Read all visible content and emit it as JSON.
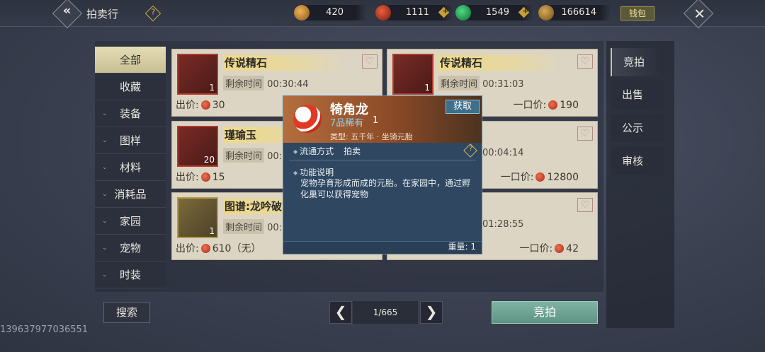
{
  "header": {
    "title": "拍卖行",
    "help_icon": "question-icon",
    "wallet_label": "钱包",
    "currencies": [
      {
        "name": "gold-ingot-icon",
        "value": "420",
        "color": "#c9862e"
      },
      {
        "name": "red-coin-icon",
        "value": "1111",
        "color": "#c23a22"
      },
      {
        "name": "jade-icon",
        "value": "1549",
        "color": "#2fae5a"
      },
      {
        "name": "bronze-icon",
        "value": "166614",
        "color": "#b58a3a"
      }
    ]
  },
  "sidebar": {
    "items": [
      {
        "label": "全部",
        "active": true
      },
      {
        "label": "收藏"
      },
      {
        "label": "装备",
        "chevron": "⌄"
      },
      {
        "label": "图样",
        "chevron": "⌄"
      },
      {
        "label": "材料",
        "chevron": "⌄"
      },
      {
        "label": "消耗品",
        "chevron": "⌄"
      },
      {
        "label": "家园",
        "chevron": "⌄"
      },
      {
        "label": "宠物",
        "chevron": "⌄"
      },
      {
        "label": "时装",
        "chevron": "⌄"
      }
    ]
  },
  "listings": [
    {
      "name": "传说精石",
      "time_label": "剩余时间",
      "time": "00:30:44",
      "qty": "1",
      "price_label": "出价:",
      "price": "30"
    },
    {
      "name": "传说精石",
      "time_label": "剩余时间",
      "time": "00:31:03",
      "qty": "1",
      "price_label": "一口价:",
      "price": "190"
    },
    {
      "name": "瑾瑜玉",
      "time_label": "剩余时间",
      "time": "00:",
      "qty": "20",
      "price_label": "出价:",
      "price": "15"
    },
    {
      "name": "",
      "time_label": "",
      "time": "00:04:14",
      "qty": "",
      "price_label": "一口价:",
      "price": "12800"
    },
    {
      "name": "图谱:龙吟破",
      "time_label": "剩余时间",
      "time": "00:",
      "qty": "1",
      "price_label": "出价:",
      "price": "610（无）"
    },
    {
      "name": "",
      "time_label": "",
      "time": "01:28:55",
      "qty": "",
      "price_label": "一口价:",
      "price": "42"
    }
  ],
  "right_tabs": [
    "竞拍",
    "出售",
    "公示",
    "审核"
  ],
  "bottom": {
    "search_label": "搜索",
    "page": "1/665",
    "bid_label": "竞拍",
    "prev": "❮",
    "next": "❯"
  },
  "user_id": "139637977036551",
  "popup": {
    "name": "犄角龙",
    "rarity": "7品稀有",
    "count": "1",
    "get_label": "获取",
    "type": "类型: 五千年 · 坐骑元胎",
    "circulation_label": "流通方式",
    "circulation_value": "拍卖",
    "function_label": "功能说明",
    "description": "宠物孕育形成而成的元胎。在家园中，通过孵化巢可以获得宠物",
    "weight": "重量: 1"
  }
}
